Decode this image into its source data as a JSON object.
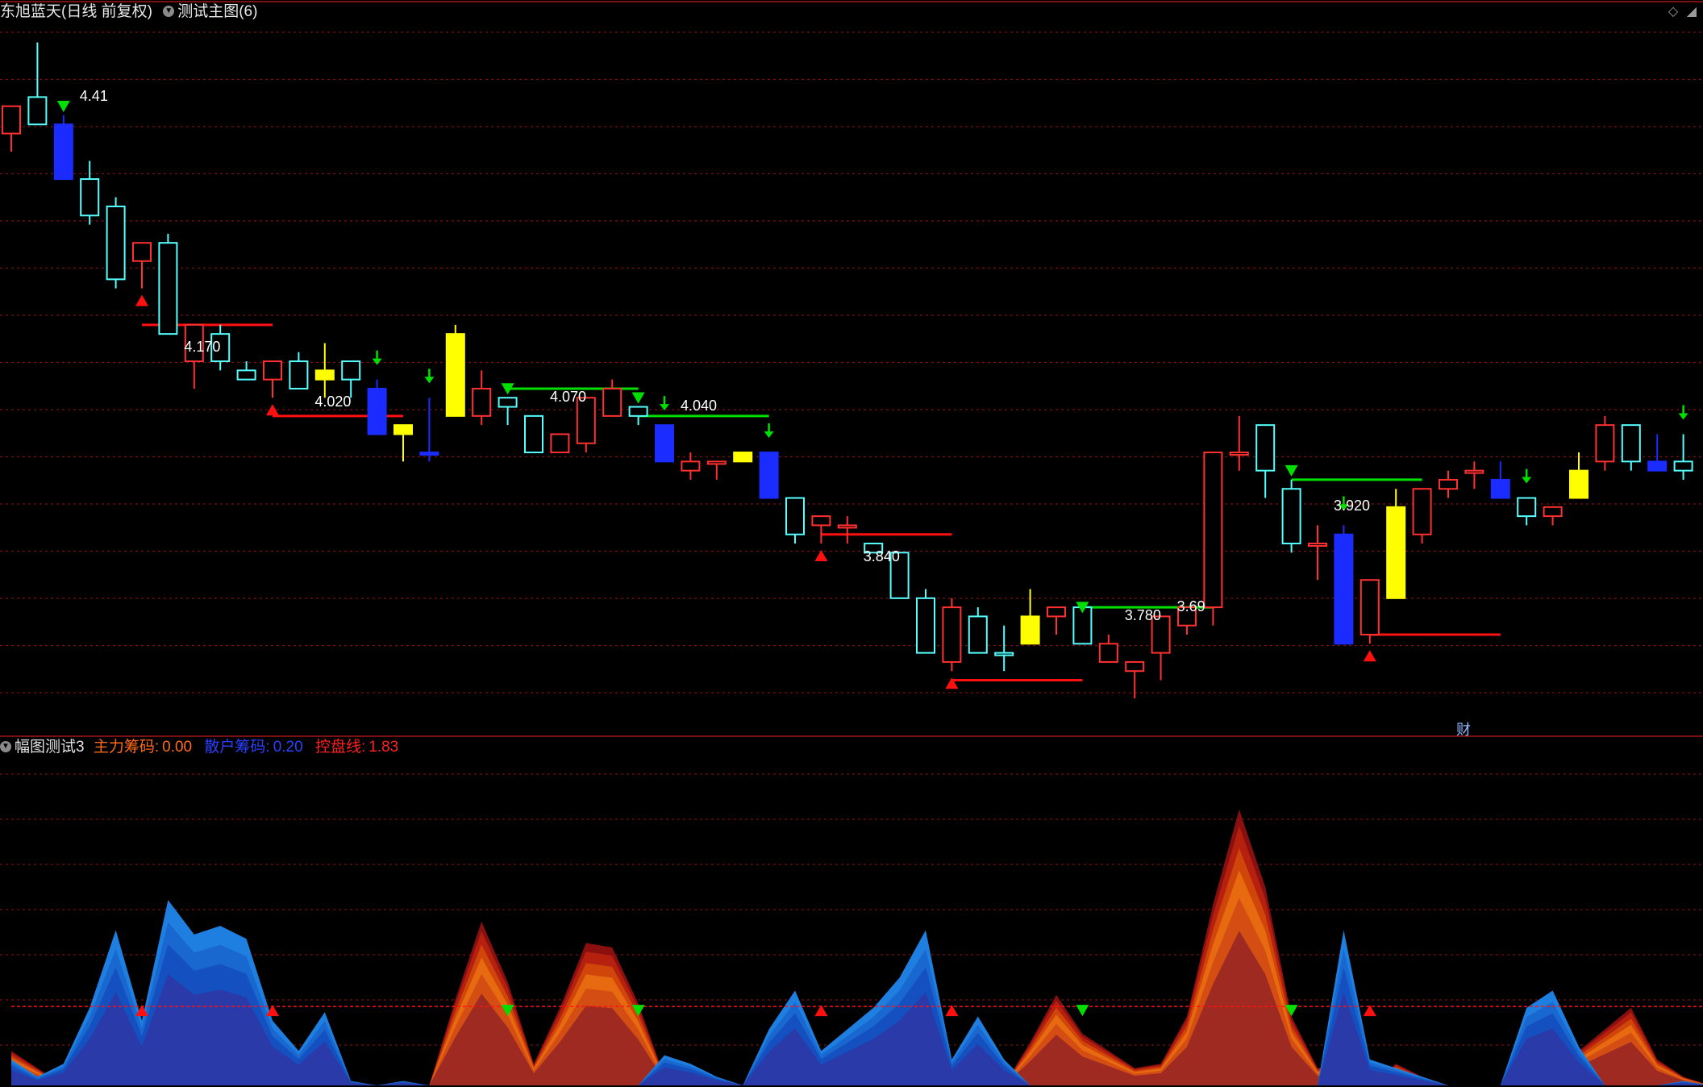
{
  "header": {
    "stock_title": "东旭蓝天(日线 前复权)",
    "main_indicator": "测试主图(6)",
    "sub_indicator": "幅图测试3",
    "main_chip_label": "主力筹码:",
    "main_chip_value": "0.00",
    "retail_chip_label": "散户筹码:",
    "retail_chip_value": "0.20",
    "control_line_label": "控盘线:",
    "control_line_value": "1.83",
    "cai_icon_label": "财"
  },
  "colors": {
    "background": "#000000",
    "up_candle": "#ff3030",
    "down_candle": "#54ffff",
    "blue_candle": "#1a2cff",
    "yellow_candle": "#ffff00",
    "signal_green": "#00e000",
    "signal_red": "#ff1010",
    "grid": "#7a1010"
  },
  "chart_data": [
    {
      "type": "candlestick",
      "title": "东旭蓝天(日线 前复权)",
      "price_labels": [
        {
          "bar": 2,
          "text": "4.41"
        },
        {
          "bar": 6,
          "text": "4.170"
        },
        {
          "bar": 11,
          "text": "4.020"
        },
        {
          "bar": 20,
          "text": "4.070"
        },
        {
          "bar": 25,
          "text": "4.040"
        },
        {
          "bar": 32,
          "text": "3.840"
        },
        {
          "bar": 42,
          "text": "3.780"
        },
        {
          "bar": 44,
          "text": "3.69"
        },
        {
          "bar": 50,
          "text": "3.920"
        }
      ],
      "ylim": [
        3.66,
        4.43
      ],
      "candles": [
        {
          "o": 4.31,
          "h": 4.34,
          "l": 4.29,
          "c": 4.34,
          "k": "up"
        },
        {
          "o": 4.35,
          "h": 4.41,
          "l": 4.32,
          "c": 4.32,
          "k": "down"
        },
        {
          "o": 4.32,
          "h": 4.33,
          "l": 4.26,
          "c": 4.26,
          "k": "blue"
        },
        {
          "o": 4.26,
          "h": 4.28,
          "l": 4.21,
          "c": 4.22,
          "k": "down"
        },
        {
          "o": 4.23,
          "h": 4.24,
          "l": 4.14,
          "c": 4.15,
          "k": "down"
        },
        {
          "o": 4.17,
          "h": 4.19,
          "l": 4.14,
          "c": 4.19,
          "k": "up"
        },
        {
          "o": 4.19,
          "h": 4.2,
          "l": 4.09,
          "c": 4.09,
          "k": "down"
        },
        {
          "o": 4.06,
          "h": 4.1,
          "l": 4.03,
          "c": 4.1,
          "k": "up"
        },
        {
          "o": 4.09,
          "h": 4.1,
          "l": 4.05,
          "c": 4.06,
          "k": "down"
        },
        {
          "o": 4.05,
          "h": 4.06,
          "l": 4.04,
          "c": 4.04,
          "k": "down"
        },
        {
          "o": 4.04,
          "h": 4.06,
          "l": 4.02,
          "c": 4.06,
          "k": "up"
        },
        {
          "o": 4.06,
          "h": 4.07,
          "l": 4.03,
          "c": 4.03,
          "k": "down"
        },
        {
          "o": 4.04,
          "h": 4.08,
          "l": 4.02,
          "c": 4.05,
          "k": "yellow"
        },
        {
          "o": 4.06,
          "h": 4.06,
          "l": 4.02,
          "c": 4.04,
          "k": "down"
        },
        {
          "o": 4.03,
          "h": 4.04,
          "l": 3.98,
          "c": 3.98,
          "k": "blue"
        },
        {
          "o": 3.98,
          "h": 3.99,
          "l": 3.95,
          "c": 3.99,
          "k": "yellow"
        },
        {
          "o": 3.96,
          "h": 4.02,
          "l": 3.95,
          "c": 3.96,
          "k": "blue"
        },
        {
          "o": 4.0,
          "h": 4.1,
          "l": 4.0,
          "c": 4.09,
          "k": "yellow"
        },
        {
          "o": 4.0,
          "h": 4.05,
          "l": 3.99,
          "c": 4.03,
          "k": "up"
        },
        {
          "o": 4.02,
          "h": 4.02,
          "l": 3.99,
          "c": 4.01,
          "k": "down"
        },
        {
          "o": 4.0,
          "h": 4.0,
          "l": 3.96,
          "c": 3.96,
          "k": "down"
        },
        {
          "o": 3.96,
          "h": 3.98,
          "l": 3.96,
          "c": 3.98,
          "k": "up"
        },
        {
          "o": 3.97,
          "h": 4.02,
          "l": 3.96,
          "c": 4.02,
          "k": "up"
        },
        {
          "o": 4.0,
          "h": 4.04,
          "l": 4.0,
          "c": 4.03,
          "k": "up"
        },
        {
          "o": 4.01,
          "h": 4.01,
          "l": 3.99,
          "c": 4.0,
          "k": "down"
        },
        {
          "o": 3.99,
          "h": 3.99,
          "l": 3.95,
          "c": 3.95,
          "k": "blue"
        },
        {
          "o": 3.95,
          "h": 3.96,
          "l": 3.93,
          "c": 3.94,
          "k": "up"
        },
        {
          "o": 3.95,
          "h": 3.95,
          "l": 3.93,
          "c": 3.95,
          "k": "up"
        },
        {
          "o": 3.96,
          "h": 3.96,
          "l": 3.95,
          "c": 3.95,
          "k": "yellow"
        },
        {
          "o": 3.96,
          "h": 3.96,
          "l": 3.91,
          "c": 3.91,
          "k": "blue"
        },
        {
          "o": 3.91,
          "h": 3.91,
          "l": 3.86,
          "c": 3.87,
          "k": "down"
        },
        {
          "o": 3.88,
          "h": 3.89,
          "l": 3.86,
          "c": 3.89,
          "k": "up"
        },
        {
          "o": 3.88,
          "h": 3.89,
          "l": 3.86,
          "c": 3.88,
          "k": "up"
        },
        {
          "o": 3.86,
          "h": 3.86,
          "l": 3.85,
          "c": 3.85,
          "k": "down"
        },
        {
          "o": 3.85,
          "h": 3.85,
          "l": 3.8,
          "c": 3.8,
          "k": "down"
        },
        {
          "o": 3.8,
          "h": 3.81,
          "l": 3.74,
          "c": 3.74,
          "k": "down"
        },
        {
          "o": 3.79,
          "h": 3.8,
          "l": 3.72,
          "c": 3.73,
          "k": "up"
        },
        {
          "o": 3.78,
          "h": 3.79,
          "l": 3.74,
          "c": 3.74,
          "k": "down"
        },
        {
          "o": 3.74,
          "h": 3.77,
          "l": 3.72,
          "c": 3.74,
          "k": "down"
        },
        {
          "o": 3.75,
          "h": 3.81,
          "l": 3.75,
          "c": 3.78,
          "k": "yellow"
        },
        {
          "o": 3.78,
          "h": 3.79,
          "l": 3.76,
          "c": 3.79,
          "k": "up"
        },
        {
          "o": 3.79,
          "h": 3.78,
          "l": 3.75,
          "c": 3.75,
          "k": "down"
        },
        {
          "o": 3.75,
          "h": 3.76,
          "l": 3.73,
          "c": 3.73,
          "k": "up"
        },
        {
          "o": 3.73,
          "h": 3.73,
          "l": 3.69,
          "c": 3.72,
          "k": "up"
        },
        {
          "o": 3.74,
          "h": 3.77,
          "l": 3.71,
          "c": 3.78,
          "k": "up"
        },
        {
          "o": 3.77,
          "h": 3.79,
          "l": 3.76,
          "c": 3.79,
          "k": "up"
        },
        {
          "o": 3.79,
          "h": 3.96,
          "l": 3.77,
          "c": 3.96,
          "k": "up"
        },
        {
          "o": 3.96,
          "h": 4.0,
          "l": 3.94,
          "c": 3.96,
          "k": "up"
        },
        {
          "o": 3.99,
          "h": 3.99,
          "l": 3.91,
          "c": 3.94,
          "k": "down"
        },
        {
          "o": 3.92,
          "h": 3.93,
          "l": 3.85,
          "c": 3.86,
          "k": "down"
        },
        {
          "o": 3.86,
          "h": 3.88,
          "l": 3.82,
          "c": 3.86,
          "k": "up"
        },
        {
          "o": 3.87,
          "h": 3.88,
          "l": 3.75,
          "c": 3.75,
          "k": "blue"
        },
        {
          "o": 3.76,
          "h": 3.82,
          "l": 3.75,
          "c": 3.82,
          "k": "up"
        },
        {
          "o": 3.8,
          "h": 3.92,
          "l": 3.8,
          "c": 3.9,
          "k": "yellow"
        },
        {
          "o": 3.87,
          "h": 3.92,
          "l": 3.86,
          "c": 3.92,
          "k": "up"
        },
        {
          "o": 3.92,
          "h": 3.94,
          "l": 3.91,
          "c": 3.93,
          "k": "up"
        },
        {
          "o": 3.94,
          "h": 3.95,
          "l": 3.92,
          "c": 3.94,
          "k": "up"
        },
        {
          "o": 3.93,
          "h": 3.95,
          "l": 3.91,
          "c": 3.91,
          "k": "blue"
        },
        {
          "o": 3.91,
          "h": 3.91,
          "l": 3.88,
          "c": 3.89,
          "k": "down"
        },
        {
          "o": 3.89,
          "h": 3.9,
          "l": 3.88,
          "c": 3.9,
          "k": "up"
        },
        {
          "o": 3.91,
          "h": 3.96,
          "l": 3.91,
          "c": 3.94,
          "k": "yellow"
        },
        {
          "o": 3.95,
          "h": 4.0,
          "l": 3.94,
          "c": 3.99,
          "k": "up"
        },
        {
          "o": 3.99,
          "h": 3.99,
          "l": 3.94,
          "c": 3.95,
          "k": "down"
        },
        {
          "o": 3.95,
          "h": 3.98,
          "l": 3.94,
          "c": 3.94,
          "k": "blue"
        },
        {
          "o": 3.94,
          "h": 3.98,
          "l": 3.93,
          "c": 3.95,
          "k": "down"
        }
      ],
      "support_lines": [
        {
          "from": 5,
          "to": 10,
          "price": 4.1,
          "color": "red"
        },
        {
          "from": 10,
          "to": 15,
          "price": 4.0,
          "color": "red"
        },
        {
          "from": 19,
          "to": 24,
          "price": 4.03,
          "color": "green"
        },
        {
          "from": 24,
          "to": 29,
          "price": 4.0,
          "color": "green"
        },
        {
          "from": 31,
          "to": 36,
          "price": 3.87,
          "color": "red"
        },
        {
          "from": 36,
          "to": 41,
          "price": 3.71,
          "color": "red"
        },
        {
          "from": 41,
          "to": 46,
          "price": 3.79,
          "color": "green"
        },
        {
          "from": 49,
          "to": 54,
          "price": 3.93,
          "color": "green"
        },
        {
          "from": 52,
          "to": 57,
          "price": 3.76,
          "color": "red"
        }
      ],
      "signals": [
        {
          "bar": 2,
          "kind": "sell-triangle"
        },
        {
          "bar": 5,
          "kind": "buy-triangle"
        },
        {
          "bar": 10,
          "kind": "buy-triangle"
        },
        {
          "bar": 14,
          "kind": "down-arrow"
        },
        {
          "bar": 16,
          "kind": "down-arrow"
        },
        {
          "bar": 19,
          "kind": "sell-triangle"
        },
        {
          "bar": 24,
          "kind": "sell-triangle"
        },
        {
          "bar": 25,
          "kind": "down-arrow"
        },
        {
          "bar": 29,
          "kind": "down-arrow"
        },
        {
          "bar": 31,
          "kind": "buy-triangle"
        },
        {
          "bar": 36,
          "kind": "buy-triangle"
        },
        {
          "bar": 41,
          "kind": "sell-triangle"
        },
        {
          "bar": 49,
          "kind": "sell-triangle"
        },
        {
          "bar": 51,
          "kind": "down-arrow"
        },
        {
          "bar": 52,
          "kind": "buy-triangle"
        },
        {
          "bar": 58,
          "kind": "down-arrow"
        },
        {
          "bar": 64,
          "kind": "down-arrow"
        }
      ]
    },
    {
      "type": "area",
      "title": "幅图测试3",
      "ylim": [
        0,
        7.5
      ],
      "control_line": 1.83,
      "series": [
        {
          "name": "主力筹码",
          "values": [
            0.8,
            0.4,
            0.0,
            0.0,
            0.0,
            0.0,
            0.0,
            0.0,
            0.0,
            0.0,
            0.0,
            0.0,
            0.0,
            0.0,
            0.0,
            0.0,
            0.0,
            2.0,
            3.8,
            2.4,
            0.5,
            1.8,
            3.3,
            3.2,
            1.9,
            0.2,
            0.0,
            0.0,
            0.0,
            0.0,
            0.0,
            0.0,
            0.0,
            0.0,
            0.0,
            0.0,
            0.0,
            0.0,
            0.0,
            1.0,
            2.1,
            1.2,
            0.8,
            0.4,
            0.5,
            1.6,
            4.2,
            6.4,
            4.6,
            1.6,
            0.4,
            0.5,
            0.0,
            0.5,
            0.2,
            0.0,
            0.0,
            0.0,
            0.0,
            0.0,
            0.8,
            1.3,
            1.8,
            0.6,
            0.2,
            0.0
          ]
        },
        {
          "name": "散户筹码",
          "values": [
            0.6,
            0.2,
            0.5,
            1.8,
            3.6,
            1.5,
            4.3,
            3.5,
            3.7,
            3.4,
            1.5,
            0.8,
            1.7,
            0.1,
            0.0,
            0.1,
            0.0,
            0.0,
            0.0,
            0.0,
            0.0,
            0.0,
            0.0,
            0.0,
            0.0,
            0.7,
            0.5,
            0.2,
            0.0,
            1.3,
            2.2,
            0.8,
            1.3,
            1.8,
            2.5,
            3.6,
            0.6,
            1.6,
            0.6,
            0.0,
            0.0,
            0.0,
            0.0,
            0.0,
            0.0,
            0.0,
            0.0,
            0.0,
            0.0,
            0.0,
            0.0,
            3.6,
            0.6,
            0.4,
            0.2,
            0.0,
            0.0,
            0.0,
            1.8,
            2.2,
            0.9,
            0.0,
            0.0,
            0.0,
            0.1,
            0.0
          ]
        }
      ],
      "signals": [
        {
          "bar": 5,
          "kind": "buy-triangle"
        },
        {
          "bar": 10,
          "kind": "buy-triangle"
        },
        {
          "bar": 19,
          "kind": "sell-triangle"
        },
        {
          "bar": 24,
          "kind": "sell-triangle"
        },
        {
          "bar": 31,
          "kind": "buy-triangle"
        },
        {
          "bar": 36,
          "kind": "buy-triangle"
        },
        {
          "bar": 41,
          "kind": "sell-triangle"
        },
        {
          "bar": 49,
          "kind": "sell-triangle"
        },
        {
          "bar": 52,
          "kind": "buy-triangle"
        }
      ]
    }
  ]
}
